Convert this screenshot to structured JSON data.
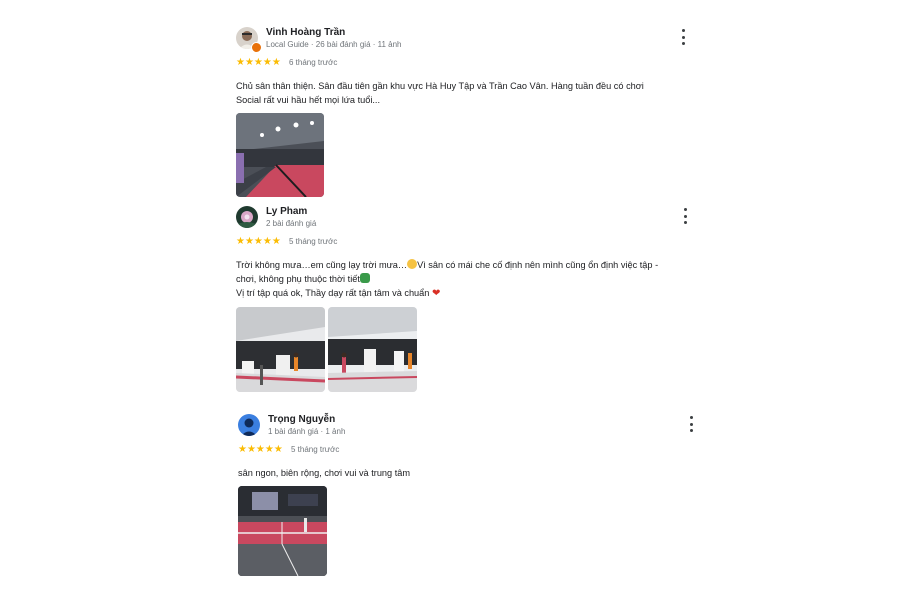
{
  "reviews": [
    {
      "name": "Vinh Hoàng Trần",
      "meta": "Local Guide · 26 bài đánh giá · 11 ảnh",
      "stars": "★★★★★",
      "rating": 5,
      "time": "6 tháng trước",
      "text_lines": [
        "Chủ sân thân thiện. Sân đầu tiên gần khu vực Hà Huy Tập và Trần Cao Vân. Hàng tuần đều có chơi",
        "Social rất vui hầu hết mọi lứa tuổi..."
      ],
      "photo_count": 1,
      "avatar_icon": "person-avatar-icon",
      "badge_icon": "local-guide-badge-icon"
    },
    {
      "name": "Ly Pham",
      "meta": "2 bài đánh giá",
      "stars": "★★★★★",
      "rating": 5,
      "time": "5 tháng trước",
      "text_lines": [
        "Trời không mưa…em cũng lạy trời mưa…",
        "Vì sân có mái che cố định nên mình cũng ổn định việc tập -",
        "chơi, không phụ thuộc thời tiết",
        "Vị trí tập quá ok, Thầy dạy rất tận tâm và chuẩn"
      ],
      "photo_count": 2,
      "avatar_icon": "flower-avatar-icon"
    },
    {
      "name": "Trọng Nguyễn",
      "meta": "1 bài đánh giá · 1 ảnh",
      "stars": "★★★★★",
      "rating": 5,
      "time": "5 tháng trước",
      "text_lines": [
        "sân ngon, biên rộng, chơi vui và trung tâm"
      ],
      "photo_count": 1,
      "avatar_icon": "blue-avatar-icon"
    }
  ],
  "colors": {
    "star": "#fbbc04",
    "court_red": "#d9566a",
    "muted_text": "#70757a"
  },
  "icons": [
    "more-vert-icon",
    "star-icon",
    "smile-emoji-icon",
    "clover-emoji-icon",
    "heart-emoji-icon"
  ]
}
